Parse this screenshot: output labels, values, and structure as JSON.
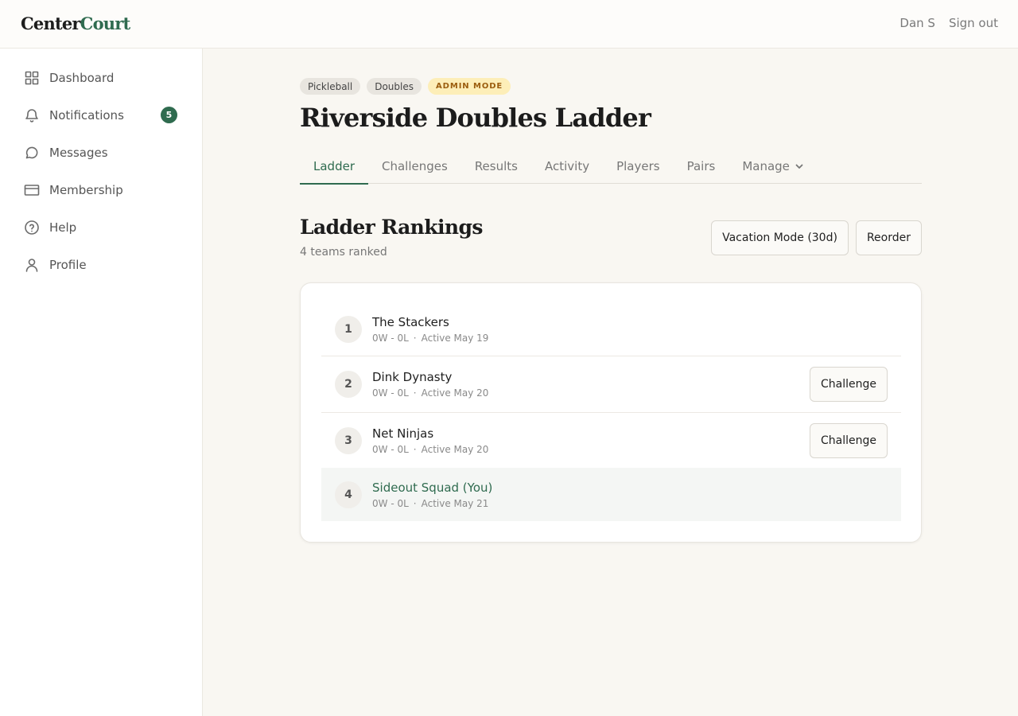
{
  "brand": {
    "part1": "Center",
    "part2": "Court"
  },
  "user_nav": {
    "user_name": "Dan S",
    "sign_out": "Sign out"
  },
  "sidebar": {
    "items": [
      {
        "label": "Dashboard",
        "icon": "grid-icon"
      },
      {
        "label": "Notifications",
        "icon": "bell-icon",
        "badge": "5"
      },
      {
        "label": "Messages",
        "icon": "chat-bubble-icon"
      },
      {
        "label": "Membership",
        "icon": "credit-card-icon"
      },
      {
        "label": "Help",
        "icon": "help-circle-icon"
      },
      {
        "label": "Profile",
        "icon": "user-icon"
      }
    ]
  },
  "header": {
    "tags": [
      "Pickleball",
      "Doubles"
    ],
    "admin_tag": "ADMIN MODE",
    "title": "Riverside Doubles Ladder"
  },
  "tabs": [
    "Ladder",
    "Challenges",
    "Results",
    "Activity",
    "Players",
    "Pairs",
    "Manage"
  ],
  "active_tab": "Ladder",
  "section": {
    "title": "Ladder Rankings",
    "subtitle": "4 teams ranked",
    "vacation_button": "Vacation Mode (30d)",
    "reorder_button": "Reorder"
  },
  "ladder": {
    "challenge_label": "Challenge",
    "rows": [
      {
        "rank": "1",
        "name": "The Stackers",
        "record": "0W - 0L",
        "active": "Active May 19",
        "challengeable": false,
        "you": false
      },
      {
        "rank": "2",
        "name": "Dink Dynasty",
        "record": "0W - 0L",
        "active": "Active May 20",
        "challengeable": true,
        "you": false
      },
      {
        "rank": "3",
        "name": "Net Ninjas",
        "record": "0W - 0L",
        "active": "Active May 20",
        "challengeable": true,
        "you": false
      },
      {
        "rank": "4",
        "name": "Sideout Squad (You)",
        "record": "0W - 0L",
        "active": "Active May 21",
        "challengeable": false,
        "you": true
      }
    ]
  },
  "colors": {
    "accent": "#2f6b4f",
    "admin_bg": "#fdeeb8",
    "admin_text": "#9b5d0e",
    "page_bg": "#f9f7f2"
  }
}
